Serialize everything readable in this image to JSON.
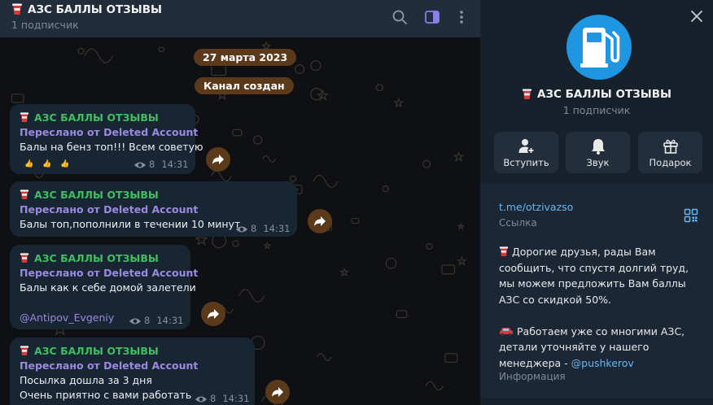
{
  "channel": {
    "name": "АЗС БАЛЛЫ ОТЗЫВЫ",
    "subscribers": "1 подписчик"
  },
  "icons": {
    "header": [
      "search-icon",
      "sidebar-toggle-icon",
      "more-vertical-icon"
    ],
    "close": "close-icon",
    "avatar": "fuel-pump-icon"
  },
  "chat": {
    "date_pill": "27 марта 2023",
    "service_pill": "Канал создан",
    "messages": [
      {
        "title": "АЗС БАЛЛЫ ОТЗЫВЫ",
        "forwarded": "Переслано от Deleted Account",
        "lines": [
          "Балы на бенз топ!!! Всем советую"
        ],
        "author": "",
        "reactions": "👍 👍 👍",
        "views": "8",
        "time": "14:31"
      },
      {
        "title": "АЗС БАЛЛЫ ОТЗЫВЫ",
        "forwarded": "Переслано от Deleted Account",
        "lines": [
          "Балы топ,пополнили в течении 10 минут"
        ],
        "author": "",
        "views": "8",
        "time": "14:31"
      },
      {
        "title": "АЗС БАЛЛЫ ОТЗЫВЫ",
        "forwarded": "Переслано от Deleted Account",
        "lines": [
          "Балы как к себе домой залетели"
        ],
        "author": "@Antipov_Evgeniy",
        "views": "8",
        "time": "14:31"
      },
      {
        "title": "АЗС БАЛЛЫ ОТЗЫВЫ",
        "forwarded": "Переслано от Deleted Account",
        "lines": [
          "Посылка дошла за 3 дня",
          "Очень приятно с вами работать"
        ],
        "author": "",
        "views": "8",
        "time": "14:31"
      }
    ]
  },
  "profile": {
    "actions": [
      {
        "label": "Вступить",
        "icon": "add-user-icon"
      },
      {
        "label": "Звук",
        "icon": "bell-icon"
      },
      {
        "label": "Подарок",
        "icon": "gift-icon"
      }
    ],
    "link": "t.me/otzivazso",
    "link_label": "Ссылка",
    "description": {
      "p1": "Дорогие друзья, рады Вам сообщить, что спустя долгий труд, мы можем предложить Вам баллы АЗС со скидкой 50%.",
      "p2": "Работаем уже со многими АЗС, детали уточняйте у нашего менеджера - ",
      "handle": "@pushkerov"
    },
    "info_label": "Информация"
  },
  "colors": {
    "accent_link": "#6ab7f5",
    "author_green": "#3fbf60",
    "forward_purple": "#9b8ae0",
    "pill_brown": "#5a3a1a",
    "avatar_blue": "#1e96e1"
  }
}
